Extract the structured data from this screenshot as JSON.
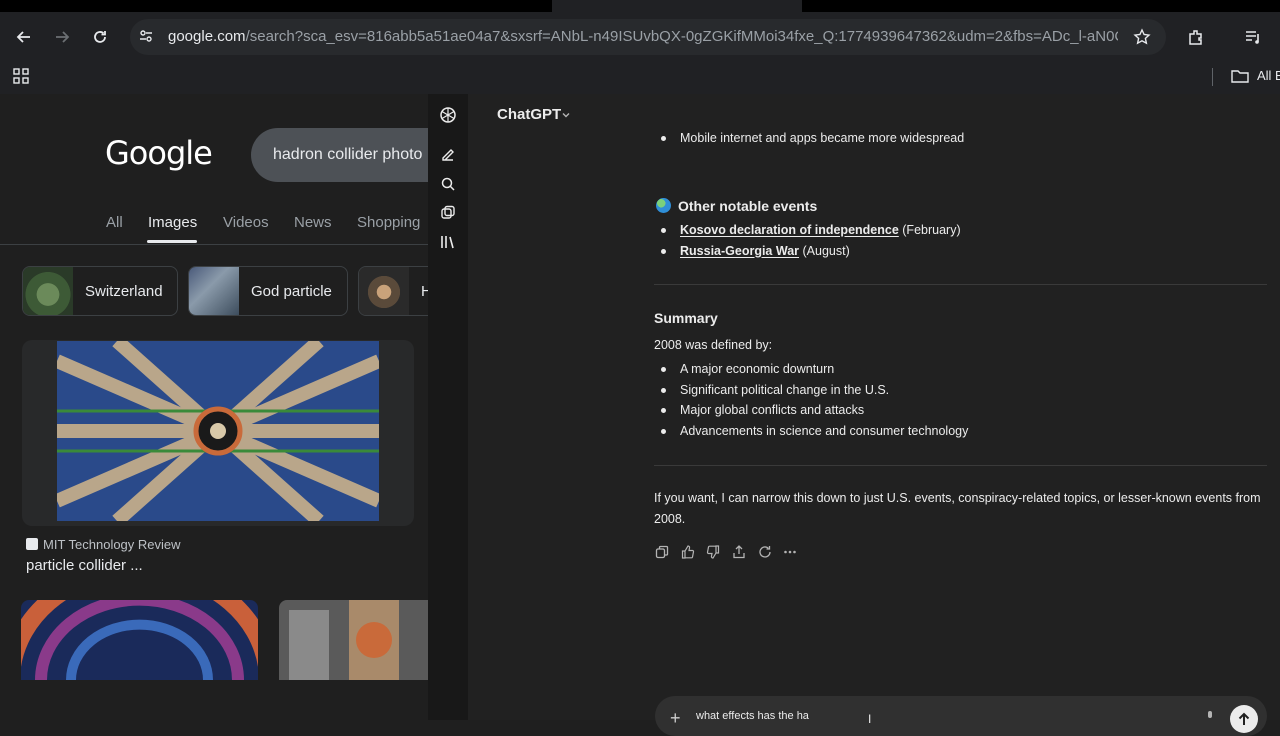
{
  "browser": {
    "url_host": "google.com",
    "url_rest": "/search?sca_esv=816abb5a51ae04a7&sxsrf=ANbL-n49ISUvbQX-0gZGKifMMoi34fxe_Q:1774939647362&udm=2&fbs=ADc_l-aN0C...",
    "bookmarks_all": "All B"
  },
  "google": {
    "logo": "Google",
    "query": "hadron collider photo",
    "tabs": [
      "All",
      "Images",
      "Videos",
      "News",
      "Shopping"
    ],
    "chips": [
      "Switzerland",
      "God particle",
      "H"
    ],
    "result": {
      "source": "MIT Technology Review",
      "title": "particle collider ..."
    }
  },
  "chatgpt": {
    "model": "ChatGPT",
    "bullet_top": "Mobile internet and apps became more widespread",
    "other_heading": "Other notable events",
    "other_events": [
      {
        "link": "Kosovo declaration of independence",
        "detail": " (February)"
      },
      {
        "link": "Russia-Georgia War",
        "detail": " (August)"
      }
    ],
    "summary_heading": "Summary",
    "summary_intro": "2008 was defined by:",
    "summary_points": [
      "A major economic downturn",
      "Significant political change in the U.S.",
      "Major global conflicts and attacks",
      "Advancements in science and consumer technology"
    ],
    "closing": "If you want, I can narrow this down to just U.S. events, conspiracy-related topics, or lesser-known events from 2008.",
    "composer_text": "what effects has the ha"
  },
  "colors": {
    "chrome_bg": "#202124",
    "chat_bg": "#212121",
    "google_bg": "#1f1f1f"
  }
}
